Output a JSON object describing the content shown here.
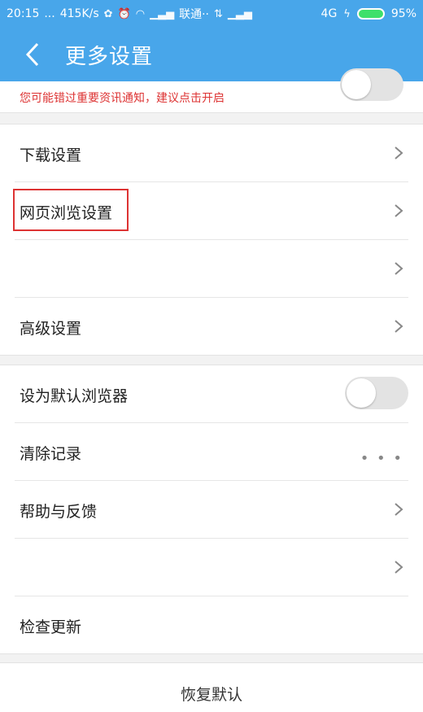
{
  "status_bar": {
    "time": "20:15",
    "dots": "...",
    "net_speed": "415K/s",
    "carrier": "联通··",
    "network": "4G",
    "battery": "95%"
  },
  "header": {
    "title": "更多设置"
  },
  "notice": {
    "text": "您可能错过重要资讯通知，建议点击开启",
    "toggle_on": false
  },
  "group1": {
    "items": [
      {
        "label": "下载设置"
      },
      {
        "label": "网页浏览设置"
      },
      {
        "label": ""
      },
      {
        "label": "高级设置"
      }
    ]
  },
  "group2": {
    "items": [
      {
        "label": "设为默认浏览器",
        "toggle_on": false
      },
      {
        "label": "清除记录",
        "more": "• • •"
      },
      {
        "label": "帮助与反馈"
      },
      {
        "label": ""
      },
      {
        "label": "检查更新"
      }
    ]
  },
  "footer": {
    "restore_label": "恢复默认"
  }
}
